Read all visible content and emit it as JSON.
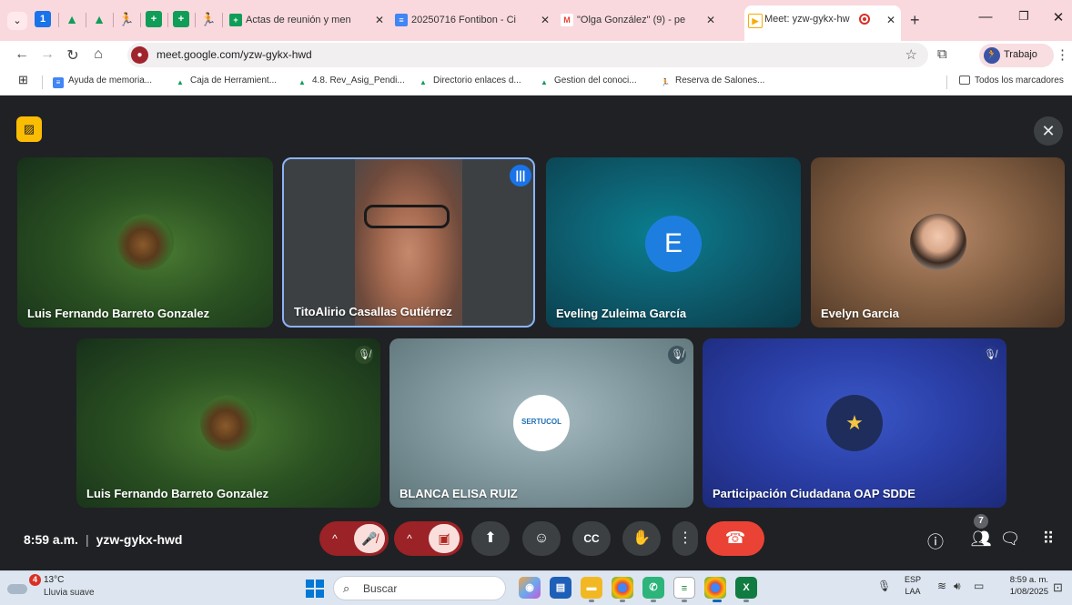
{
  "browser": {
    "tabs": [
      {
        "title": "Actas de reunión y men",
        "color": "#0f9d58",
        "icon": "sheets-icon"
      },
      {
        "title": "20250716 Fontibon - Ci",
        "color": "#4285f4",
        "icon": "docs-icon"
      },
      {
        "title": "\"Olga González\" (9) - pe",
        "color": "#ea4335",
        "icon": "gmail-icon"
      },
      {
        "title": "Meet: yzw-gykx-hw",
        "color": "#f9ab00",
        "icon": "meet-icon",
        "active": true
      }
    ],
    "url": "meet.google.com/yzw-gykx-hwd",
    "profile_label": "Trabajo",
    "bookmarks": [
      "Ayuda de memoria...",
      "Caja de Herramient...",
      "4.8. Rev_Asig_Pendi...",
      "Directorio enlaces d...",
      "Gestion del conoci...",
      "Reserva de Salones..."
    ],
    "all_bookmarks": "Todos los marcadores"
  },
  "meeting": {
    "time": "8:59 a.m.",
    "code": "yzw-gykx-hwd",
    "participant_count": "7",
    "participants": [
      {
        "name": "Luis Fernando Barreto Gonzalez",
        "type": "photo"
      },
      {
        "name": "TitoAlirio Casallas Gutiérrez",
        "type": "video",
        "speaking": true
      },
      {
        "name": "Eveling Zuleima García",
        "type": "letter",
        "initial": "E"
      },
      {
        "name": "Evelyn Garcia",
        "type": "photo"
      },
      {
        "name": "Luis Fernando Barreto Gonzalez",
        "type": "photo",
        "muted": true
      },
      {
        "name": "BLANCA ELISA RUIZ",
        "type": "logo",
        "muted": true,
        "logo_text": "SERTUCOL"
      },
      {
        "name": "Participación Ciudadana OAP SDDE",
        "type": "logo",
        "muted": true
      }
    ]
  },
  "taskbar": {
    "weather_badge": "4",
    "temperature": "13°C",
    "weather": "Lluvia suave",
    "search_placeholder": "Buscar",
    "lang_1": "ESP",
    "lang_2": "LAA",
    "time": "8:59 a. m.",
    "date": "1/08/2025"
  }
}
